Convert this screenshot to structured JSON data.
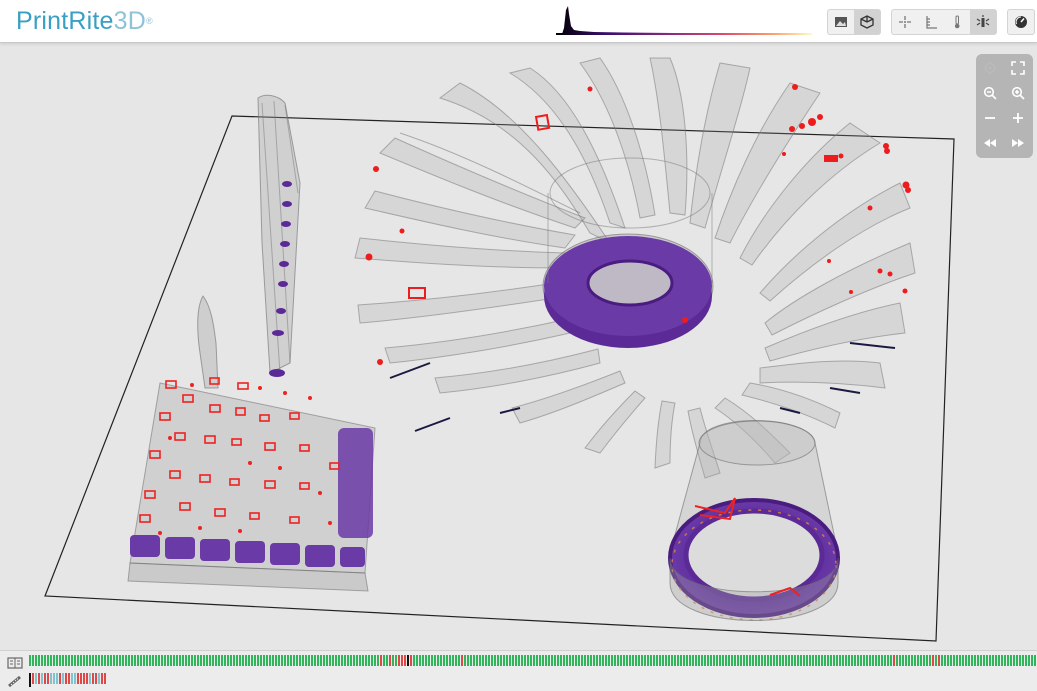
{
  "app": {
    "logo_text_primary": "PrintRite",
    "logo_text_secondary": "3D",
    "logo_mark": "®",
    "brand_color": "#3a9fc4"
  },
  "toolbar": {
    "view_group": [
      {
        "icon": "image-icon",
        "active": false
      },
      {
        "icon": "cube-icon",
        "active": true
      }
    ],
    "tools_group": [
      {
        "icon": "crosshair-icon"
      },
      {
        "icon": "ruler-icon"
      },
      {
        "icon": "thermometer-icon"
      },
      {
        "icon": "signal-icon",
        "active": true
      }
    ],
    "settings_icon": "gauge-icon"
  },
  "histogram": {
    "colors": [
      "#000000",
      "#3b0f70",
      "#8c2981",
      "#de4968",
      "#fe9f6d",
      "#fcfdbf"
    ]
  },
  "nav_controls": [
    {
      "icon": "locate-icon",
      "enabled": false
    },
    {
      "icon": "fullscreen-icon",
      "enabled": true
    },
    {
      "icon": "zoom-out-icon",
      "enabled": true
    },
    {
      "icon": "zoom-in-icon",
      "enabled": true
    },
    {
      "icon": "minus-icon",
      "enabled": true
    },
    {
      "icon": "plus-icon",
      "enabled": true
    },
    {
      "icon": "rewind-icon",
      "enabled": true
    },
    {
      "icon": "fast-forward-icon",
      "enabled": true
    }
  ],
  "timeline": {
    "layers_icon": "layers-icon",
    "measure_icon": "measure-icon",
    "status_colors": {
      "ok": "#2fb55a",
      "warn": "#e04848",
      "info": "#7fc3d0",
      "marker": "#111111"
    }
  }
}
